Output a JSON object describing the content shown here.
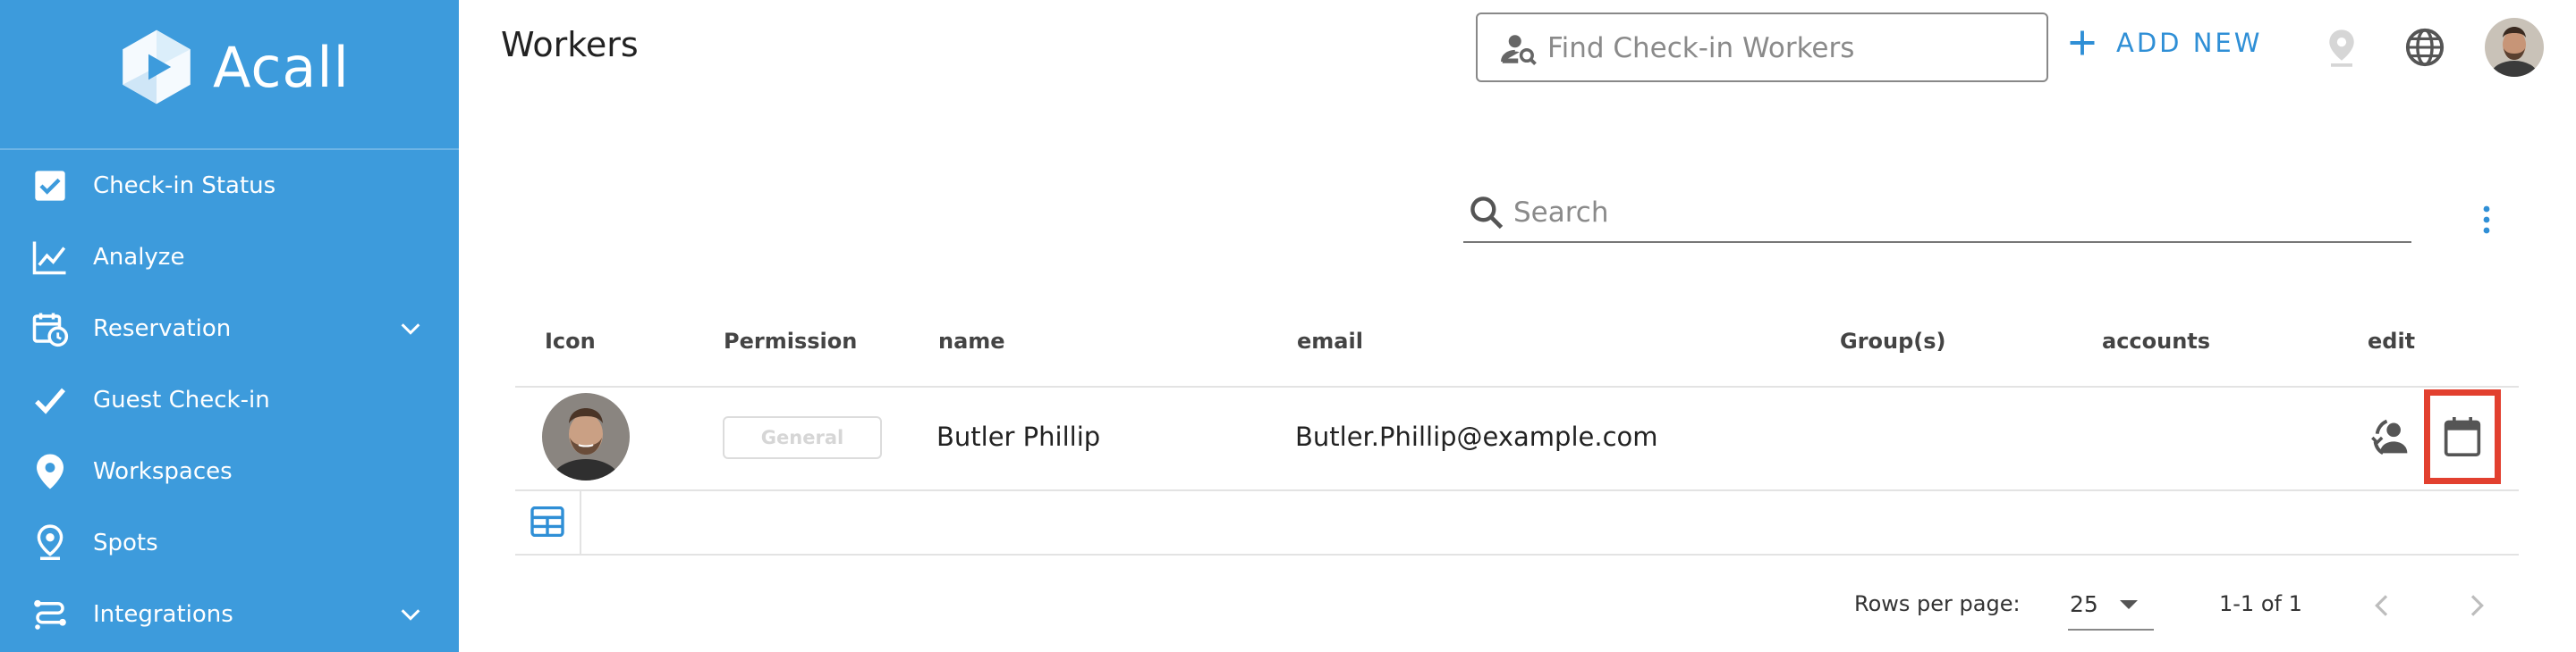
{
  "app": {
    "brand": "Acall",
    "colors": {
      "sidebar": "#3d9bdc",
      "accent": "#2f8fd6",
      "highlight": "#e2402f"
    }
  },
  "sidebar": {
    "items": [
      {
        "label": "Check-in Status",
        "icon": "checkbox-icon",
        "expandable": false
      },
      {
        "label": "Analyze",
        "icon": "line-chart-icon",
        "expandable": false
      },
      {
        "label": "Reservation",
        "icon": "calendar-clock-icon",
        "expandable": true
      },
      {
        "label": "Guest Check-in",
        "icon": "check-icon",
        "expandable": false
      },
      {
        "label": "Workspaces",
        "icon": "location-pin-icon",
        "expandable": false
      },
      {
        "label": "Spots",
        "icon": "spot-pin-icon",
        "expandable": false
      },
      {
        "label": "Integrations",
        "icon": "integrations-icon",
        "expandable": true
      }
    ]
  },
  "header": {
    "title": "Workers",
    "find_placeholder": "Find Check-in Workers",
    "add_new_label": "ADD NEW"
  },
  "search": {
    "placeholder": "Search"
  },
  "table": {
    "columns": [
      "Icon",
      "Permission",
      "name",
      "email",
      "Group(s)",
      "accounts",
      "edit"
    ],
    "rows": [
      {
        "permission": "General",
        "name": "Butler Phillip",
        "email": "Butler.Phillip@example.com",
        "groups": "",
        "accounts": ""
      }
    ]
  },
  "pagination": {
    "rows_per_page_label": "Rows per page:",
    "rows_per_page": "25",
    "range": "1-1 of 1"
  }
}
